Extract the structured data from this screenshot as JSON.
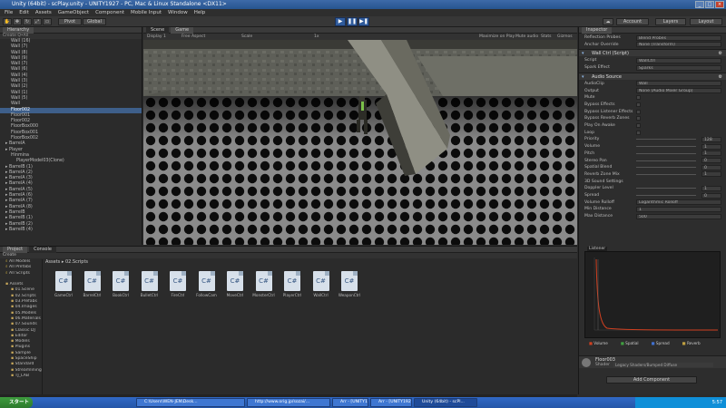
{
  "window": {
    "title": "Unity (64bit) - scPlay.unity - UNITY1927 - PC, Mac & Linux Standalone <DX11>"
  },
  "menu": [
    "File",
    "Edit",
    "Assets",
    "GameObject",
    "Component",
    "Mobile Input",
    "Window",
    "Help"
  ],
  "toolbar": {
    "pivot": "Pivot",
    "local": "Global",
    "account": "Account",
    "layers": "Layers",
    "layout": "Layout"
  },
  "hierarchy": {
    "tab": "Hierarchy",
    "create": "Create",
    "search": "Q•All",
    "items": [
      {
        "t": "Wall (16)",
        "lvl": 1
      },
      {
        "t": "Wall (7)",
        "lvl": 1
      },
      {
        "t": "Wall (8)",
        "lvl": 1
      },
      {
        "t": "Wall (9)",
        "lvl": 1
      },
      {
        "t": "Wall (7)",
        "lvl": 1
      },
      {
        "t": "Wall (6)",
        "lvl": 1
      },
      {
        "t": "Wall (4)",
        "lvl": 1
      },
      {
        "t": "Wall (3)",
        "lvl": 1
      },
      {
        "t": "Wall (2)",
        "lvl": 1
      },
      {
        "t": "Wall (1)",
        "lvl": 1
      },
      {
        "t": "Wall (5)",
        "lvl": 1
      },
      {
        "t": "Wall",
        "lvl": 1
      },
      {
        "t": "Floor002",
        "lvl": 1,
        "sel": true
      },
      {
        "t": "Floor001",
        "lvl": 1
      },
      {
        "t": "Floor002",
        "lvl": 1
      },
      {
        "t": "FloorBox000",
        "lvl": 1
      },
      {
        "t": "FloorBox001",
        "lvl": 1
      },
      {
        "t": "FloorBox002",
        "lvl": 1
      },
      {
        "t": "BarrelA",
        "lvl": 0
      },
      {
        "t": "Player",
        "lvl": 0
      },
      {
        "t": "Hinmina",
        "lvl": 1
      },
      {
        "t": "PlayerModel03(Clone)",
        "lvl": 2
      },
      {
        "t": "BarrelB (1)",
        "lvl": 0
      },
      {
        "t": "BarrelA (2)",
        "lvl": 0
      },
      {
        "t": "BarrelA (3)",
        "lvl": 0
      },
      {
        "t": "BarrelA (4)",
        "lvl": 0
      },
      {
        "t": "BarrelA (5)",
        "lvl": 0
      },
      {
        "t": "BarrelA (6)",
        "lvl": 0
      },
      {
        "t": "BarrelA (7)",
        "lvl": 0
      },
      {
        "t": "BarrelA (8)",
        "lvl": 0
      },
      {
        "t": "BarrelB",
        "lvl": 0
      },
      {
        "t": "BarrelB (1)",
        "lvl": 0
      },
      {
        "t": "BarrelB (2)",
        "lvl": 0
      },
      {
        "t": "BarrelB (4)",
        "lvl": 0
      }
    ]
  },
  "scene": {
    "tab_scene": "Scene",
    "tab_game": "Game",
    "display": "Display 1",
    "aspect": "Free Aspect",
    "scale": "Scale",
    "scale_val": "1x",
    "maximize": "Maximize on Play",
    "mute": "Mute audio",
    "stats": "Stats",
    "gizmos": "Gizmos"
  },
  "inspector": {
    "tab": "Inspector",
    "top": [
      {
        "l": "Reflection Probes",
        "v": "Blend Probes"
      },
      {
        "l": "Anchor Override",
        "v": "None (Transform)"
      }
    ],
    "script": {
      "name": "Wall Ctrl (Script)",
      "rows": [
        {
          "l": "Script",
          "v": "WallCtrl"
        },
        {
          "l": "Spark Effect",
          "v": "Sparks"
        }
      ]
    },
    "audio": {
      "name": "Audio Source",
      "rows": [
        {
          "l": "AudioClip",
          "v": "Wall",
          "k": "field"
        },
        {
          "l": "Output",
          "v": "None (Audio Mixer Group)",
          "k": "field"
        },
        {
          "l": "Mute",
          "k": "chk"
        },
        {
          "l": "Bypass Effects",
          "k": "chk"
        },
        {
          "l": "Bypass Listener Effects",
          "k": "chk"
        },
        {
          "l": "Bypass Reverb Zones",
          "k": "chk"
        },
        {
          "l": "Play On Awake",
          "k": "chk"
        },
        {
          "l": "Loop",
          "k": "chk"
        },
        {
          "l": "Priority",
          "v": "128",
          "k": "slider"
        },
        {
          "l": "Volume",
          "v": "1",
          "k": "slider"
        },
        {
          "l": "Pitch",
          "v": "1",
          "k": "slider"
        },
        {
          "l": "Stereo Pan",
          "v": "0",
          "k": "slider"
        },
        {
          "l": "Spatial Blend",
          "v": "0",
          "k": "slider"
        },
        {
          "l": "Reverb Zone Mix",
          "v": "1",
          "k": "slider"
        },
        {
          "l": "3D Sound Settings",
          "k": "head"
        },
        {
          "l": "Doppler Level",
          "v": "1",
          "k": "slider"
        },
        {
          "l": "Spread",
          "v": "0",
          "k": "slider"
        },
        {
          "l": "Volume Rolloff",
          "v": "Logarithmic Rolloff",
          "k": "field"
        },
        {
          "l": "Min Distance",
          "v": "1",
          "k": "field"
        },
        {
          "l": "Max Distance",
          "v": "500",
          "k": "field"
        }
      ]
    },
    "listener": "Listener",
    "legend": [
      "Volume",
      "Spatial",
      "Spread",
      "Reverb"
    ],
    "material": {
      "name": "Floor003",
      "shader": "Shader",
      "shader_val": "Legacy Shaders/Bumped Diffuse"
    },
    "add_component": "Add Component"
  },
  "project": {
    "tab_project": "Project",
    "tab_console": "Console",
    "create": "Create",
    "breadcrumb": "Assets ▸ 02.Scripts",
    "favorites": [
      "All Models",
      "All Prefabs",
      "All Scripts"
    ],
    "tree": [
      "Assets",
      "01.Scene",
      "02.Scripts",
      "03.Prefabs",
      "04.Images",
      "05.Models",
      "06.Materials",
      "07.Sounds",
      "Classic DJ",
      "Editor",
      "Models",
      "Plugins",
      "Sample",
      "SpaceShip",
      "Standard",
      "Streamlining",
      "TJ_LAB"
    ],
    "assets": [
      "GameCtrl",
      "BarrelCtrl",
      "BookCtrl",
      "BulletCtrl",
      "FireCtrl",
      "FollowCam",
      "MoveCtrl",
      "MonsterCtrl",
      "PlayerCtrl",
      "WallCtrl",
      "WeaponCtrl"
    ]
  },
  "taskbar": {
    "start": "スタート",
    "tasks": [
      "C:\\Users\\WEN-JEN\\Desk...",
      "http://www.orig.jp/sozai/...",
      "Arr - [UNITY1]",
      "Arr - [UNITY1927]",
      "Unity (64bit) - scPl..."
    ],
    "clock": "5:57"
  },
  "colors": {
    "selection": "#3e5f8a",
    "play": "#2f5b9c",
    "floor": "#8c8c8c"
  }
}
